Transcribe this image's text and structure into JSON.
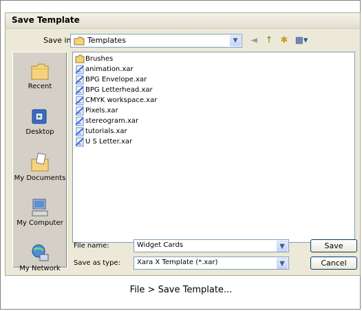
{
  "dialog": {
    "title": "Save Template",
    "save_in_label": "Save in:",
    "save_in_value": "Templates",
    "dropdown_glyph": "▼",
    "toolbar": [
      {
        "name": "back-icon",
        "glyph": "◄"
      },
      {
        "name": "up-folder-icon",
        "glyph": "↑"
      },
      {
        "name": "new-folder-icon",
        "glyph": "✱"
      },
      {
        "name": "view-menu-icon",
        "glyph": "▦▾"
      }
    ]
  },
  "places": [
    {
      "label": "Recent",
      "icon": "recent-folder-icon"
    },
    {
      "label": "Desktop",
      "icon": "desktop-icon"
    },
    {
      "label": "My Documents",
      "icon": "my-documents-icon"
    },
    {
      "label": "My Computer",
      "icon": "my-computer-icon"
    },
    {
      "label": "My Network",
      "icon": "my-network-icon"
    }
  ],
  "files": [
    {
      "name": "Brushes",
      "type": "folder"
    },
    {
      "name": "animation.xar",
      "type": "xar"
    },
    {
      "name": "BPG Envelope.xar",
      "type": "xar"
    },
    {
      "name": "BPG Letterhead.xar",
      "type": "xar"
    },
    {
      "name": "CMYK workspace.xar",
      "type": "xar"
    },
    {
      "name": "Pixels.xar",
      "type": "xar"
    },
    {
      "name": "stereogram.xar",
      "type": "xar"
    },
    {
      "name": "tutorials.xar",
      "type": "xar"
    },
    {
      "name": "U S Letter.xar",
      "type": "xar"
    }
  ],
  "form": {
    "file_name_label": "File name:",
    "file_name_value": "Widget Cards",
    "save_type_label": "Save as type:",
    "save_type_value": "Xara X  Template (*.xar)",
    "save_button": "Save",
    "cancel_button": "Cancel"
  },
  "caption": "File > Save Template...",
  "colors": {
    "dialog_bg": "#ece9d8",
    "field_border": "#7f9db9",
    "folder": "#f4d37c",
    "xar_doc": "#3b6fd1"
  }
}
